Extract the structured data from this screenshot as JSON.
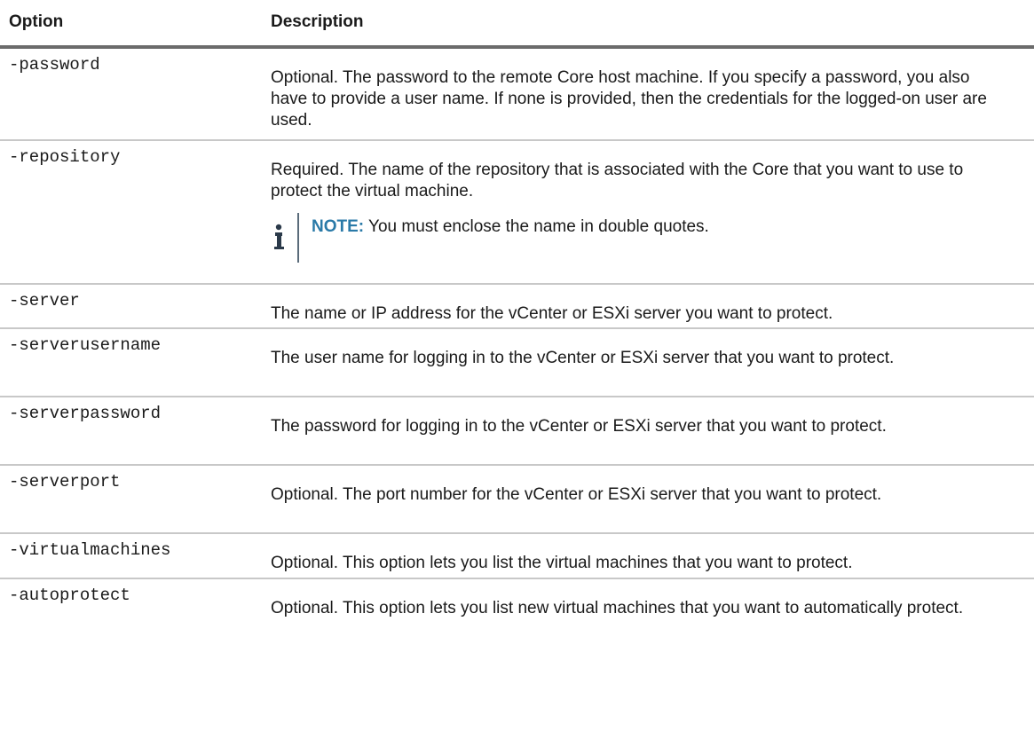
{
  "header": {
    "option_label": "Option",
    "description_label": "Description"
  },
  "rows": [
    {
      "option": "-password",
      "description": "Optional. The password to the remote Core host machine. If you specify a password, you also have to provide a user name. If none is provided, then the credentials for the logged-on user are used."
    },
    {
      "option": "-repository",
      "description": "Required. The name of the repository that is associated with the Core that you want to use to protect the virtual machine.",
      "note": {
        "icon": "info-icon",
        "label": "NOTE:",
        "text": " You must enclose the name in double quotes."
      }
    },
    {
      "option": "-server",
      "description": "The name or IP address for the vCenter or ESXi server you want to protect."
    },
    {
      "option": "-serverusername",
      "description": "The user name for logging in to the vCenter or ESXi server that you want to protect."
    },
    {
      "option": "-serverpassword",
      "description": "The password for logging in to the vCenter or ESXi server that you want to protect."
    },
    {
      "option": "-serverport",
      "description": "Optional. The port number for the vCenter or ESXi server that you want to protect."
    },
    {
      "option": "-virtualmachines",
      "description": "Optional. This option lets you list the virtual machines that you want to protect."
    },
    {
      "option": "-autoprotect",
      "description": "Optional. This option lets you list new virtual machines that you want to automatically protect."
    }
  ],
  "colors": {
    "header_rule": "#6b6b6b",
    "row_rule": "#c8c8c8",
    "note_label": "#2a7aa8",
    "note_bar": "#5a6b7a"
  }
}
